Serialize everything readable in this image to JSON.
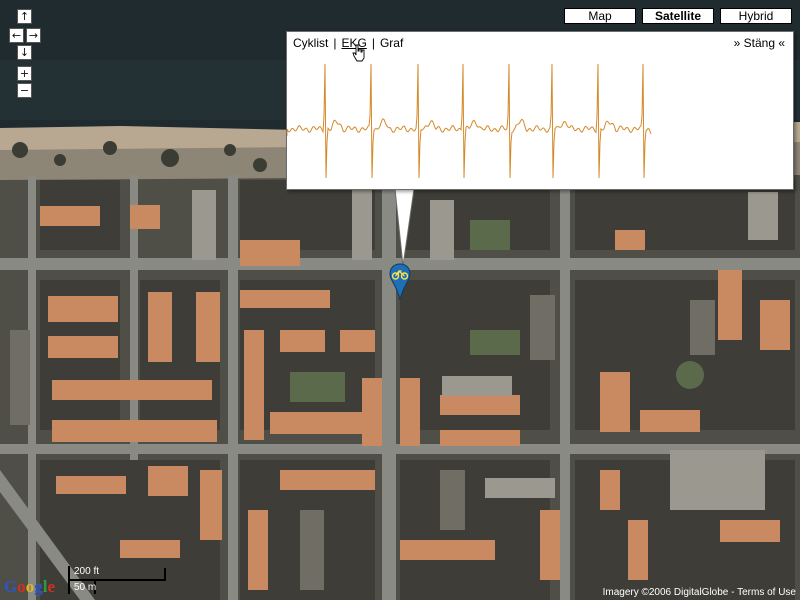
{
  "map_type_buttons": {
    "map": "Map",
    "satellite": "Satellite",
    "hybrid": "Hybrid",
    "active": "Satellite"
  },
  "nav_controls": {
    "up": "↑",
    "left": "←",
    "right": "→",
    "down": "↓",
    "zoom_in": "+",
    "zoom_out": "−"
  },
  "info_window": {
    "tabs": [
      "Cyklist",
      "EKG",
      "Graf"
    ],
    "active_tab": "EKG",
    "tab_separator": "|",
    "close_label": "» Stäng «",
    "trace_color": "#d48a2a"
  },
  "marker": {
    "icon": "bicycle-icon",
    "color": "#1f6fb6",
    "accent": "#ffe24a"
  },
  "scale_bar": {
    "imperial": "200 ft",
    "metric": "50 m"
  },
  "logo": {
    "text": "Google"
  },
  "copyright": {
    "imagery": "Imagery ©2006 DigitalGlobe",
    "separator": " - ",
    "terms": "Terms of Use"
  }
}
